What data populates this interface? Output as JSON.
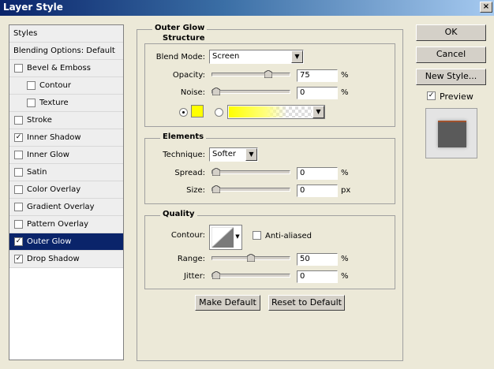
{
  "window": {
    "title": "Layer Style",
    "close_glyph": "×"
  },
  "left_panel": {
    "items": [
      {
        "label": "Styles",
        "checkbox": false,
        "checked": false,
        "indent": 0
      },
      {
        "label": "Blending Options: Default",
        "checkbox": false,
        "checked": false,
        "indent": 0
      },
      {
        "label": "Bevel & Emboss",
        "checkbox": true,
        "checked": false,
        "indent": 0
      },
      {
        "label": "Contour",
        "checkbox": true,
        "checked": false,
        "indent": 1
      },
      {
        "label": "Texture",
        "checkbox": true,
        "checked": false,
        "indent": 1
      },
      {
        "label": "Stroke",
        "checkbox": true,
        "checked": false,
        "indent": 0
      },
      {
        "label": "Inner Shadow",
        "checkbox": true,
        "checked": true,
        "indent": 0
      },
      {
        "label": "Inner Glow",
        "checkbox": true,
        "checked": false,
        "indent": 0
      },
      {
        "label": "Satin",
        "checkbox": true,
        "checked": false,
        "indent": 0
      },
      {
        "label": "Color Overlay",
        "checkbox": true,
        "checked": false,
        "indent": 0
      },
      {
        "label": "Gradient Overlay",
        "checkbox": true,
        "checked": false,
        "indent": 0
      },
      {
        "label": "Pattern Overlay",
        "checkbox": true,
        "checked": false,
        "indent": 0
      },
      {
        "label": "Outer Glow",
        "checkbox": true,
        "checked": true,
        "indent": 0,
        "selected": true
      },
      {
        "label": "Drop Shadow",
        "checkbox": true,
        "checked": true,
        "indent": 0
      }
    ]
  },
  "outer_glow": {
    "title": "Outer Glow",
    "structure": {
      "title": "Structure",
      "blend_mode_label": "Blend Mode:",
      "blend_mode_value": "Screen",
      "opacity_label": "Opacity:",
      "opacity_value": "75",
      "opacity_unit": "%",
      "opacity_level": 0.75,
      "noise_label": "Noise:",
      "noise_value": "0",
      "noise_unit": "%",
      "noise_level": 0,
      "color_swatch": "#ffff00",
      "solid_selected": true
    },
    "elements": {
      "title": "Elements",
      "technique_label": "Technique:",
      "technique_value": "Softer",
      "spread_label": "Spread:",
      "spread_value": "0",
      "spread_unit": "%",
      "spread_level": 0,
      "size_label": "Size:",
      "size_value": "0",
      "size_unit": "px",
      "size_level": 0
    },
    "quality": {
      "title": "Quality",
      "contour_label": "Contour:",
      "anti_aliased_label": "Anti-aliased",
      "anti_aliased_checked": false,
      "range_label": "Range:",
      "range_value": "50",
      "range_unit": "%",
      "range_level": 0.5,
      "jitter_label": "Jitter:",
      "jitter_value": "0",
      "jitter_unit": "%",
      "jitter_level": 0
    },
    "make_default_label": "Make Default",
    "reset_default_label": "Reset to Default"
  },
  "right_panel": {
    "ok_label": "OK",
    "cancel_label": "Cancel",
    "new_style_label": "New Style...",
    "preview_label": "Preview",
    "preview_checked": true
  },
  "colors": {
    "selection": "#0a246a",
    "glow_color": "#ffff00",
    "preview_swatch": "#5a5a5a"
  },
  "icons": {
    "check": "checkmark-icon",
    "dropdown": "chevron-down-icon",
    "thumb": "slider-thumb-icon",
    "contour": "contour-curve-icon"
  }
}
